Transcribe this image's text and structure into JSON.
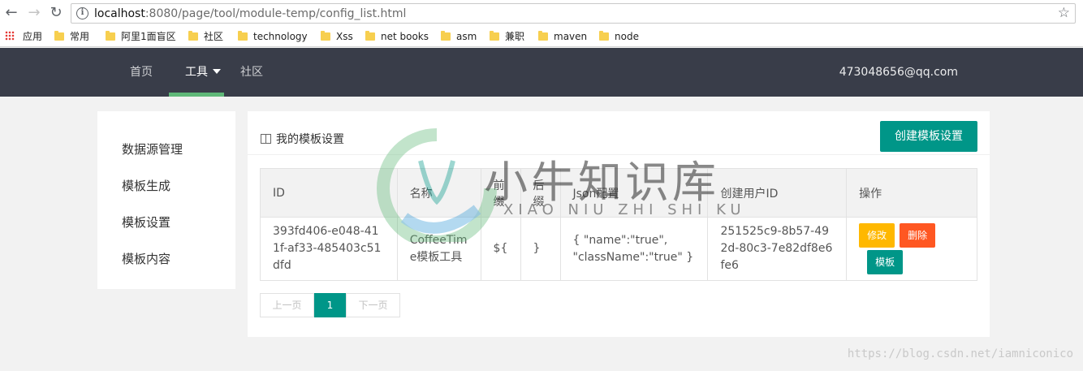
{
  "browser": {
    "url_host": "localhost",
    "url_path": ":8080/page/tool/module-temp/config_list.html",
    "bookmarks": [
      {
        "label": "应用",
        "icon": "apps-grid-icon"
      },
      {
        "label": "常用",
        "icon": "folder-icon"
      },
      {
        "label": "阿里1面盲区",
        "icon": "folder-icon"
      },
      {
        "label": "社区",
        "icon": "folder-icon"
      },
      {
        "label": "technology",
        "icon": "folder-icon"
      },
      {
        "label": "Xss",
        "icon": "folder-icon"
      },
      {
        "label": "net books",
        "icon": "folder-icon"
      },
      {
        "label": "asm",
        "icon": "folder-icon"
      },
      {
        "label": "兼职",
        "icon": "folder-icon"
      },
      {
        "label": "maven",
        "icon": "folder-icon"
      },
      {
        "label": "node",
        "icon": "folder-icon"
      }
    ]
  },
  "nav": {
    "items": [
      "首页",
      "工具",
      "社区"
    ],
    "active": "工具",
    "user": "473048656@qq.com",
    "accent": "#5fb878",
    "bg": "#393d49"
  },
  "sidebar": {
    "items": [
      "数据源管理",
      "模板生成",
      "模板设置",
      "模板内容"
    ]
  },
  "main": {
    "title": "我的模板设置",
    "create_button": "创建模板设置",
    "table": {
      "headers": [
        "ID",
        "名称",
        "前缀",
        "后缀",
        "Json配置",
        "创建用户ID",
        "操作"
      ],
      "rows": [
        {
          "id": "393fd406-e048-411f-af33-485403c51dfd",
          "name": "CoffeeTime模板工具",
          "prefix": "${",
          "suffix": "}",
          "json": "{ \"name\":\"true\", \"className\":\"true\" }",
          "user_id": "251525c9-8b57-492d-80c3-7e82df8e6fe6"
        }
      ],
      "actions": {
        "edit": "修改",
        "delete": "删除",
        "template": "模板"
      }
    },
    "pager": {
      "prev": "上一页",
      "current": "1",
      "next": "下一页"
    }
  },
  "watermark": {
    "brand": "小牛知识库",
    "brand_sub": "XIAO NIU ZHI SHI KU",
    "url": "https://blog.csdn.net/iamniconico"
  },
  "colors": {
    "primary": "#009688",
    "warn": "#ffb800",
    "danger": "#ff5722"
  }
}
